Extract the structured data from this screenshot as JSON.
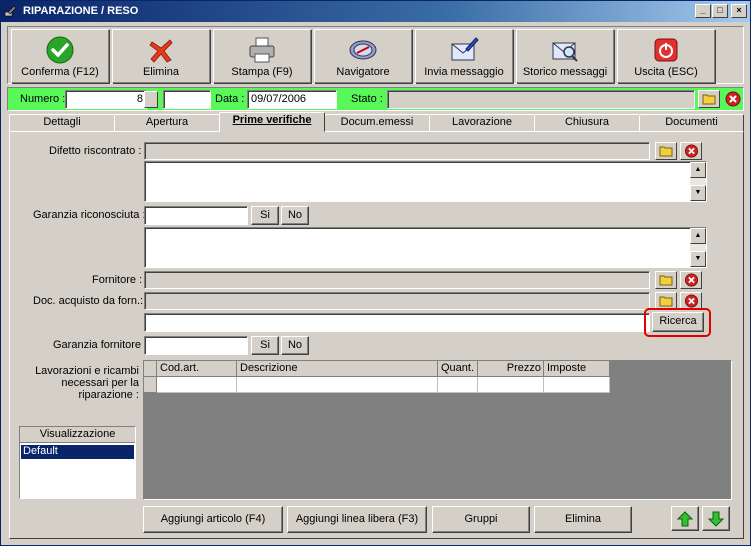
{
  "window": {
    "title": "RIPARAZIONE / RESO",
    "controls": {
      "minimize": "_",
      "maximize": "□",
      "close": "×"
    }
  },
  "toolbar": {
    "buttons": [
      {
        "label": "Conferma (F12)",
        "icon": "checkmark-icon"
      },
      {
        "label": "Elimina",
        "icon": "delete-x-icon"
      },
      {
        "label": "Stampa (F9)",
        "icon": "printer-icon"
      },
      {
        "label": "Navigatore",
        "icon": "compass-icon"
      },
      {
        "label": "Invia messaggio",
        "icon": "envelope-pen-icon"
      },
      {
        "label": "Storico messaggi",
        "icon": "envelope-search-icon"
      },
      {
        "label": "Uscita (ESC)",
        "icon": "power-icon"
      }
    ]
  },
  "header": {
    "numero_label": "Numero :",
    "numero_value": "8",
    "data_label": "Data :",
    "data_value": "09/07/2006",
    "stato_label": "Stato :",
    "stato_value": ""
  },
  "tabs": [
    {
      "label": "Dettagli",
      "active": false
    },
    {
      "label": "Apertura",
      "active": false
    },
    {
      "label": "Prime verifiche",
      "active": true
    },
    {
      "label": "Docum.emessi",
      "active": false
    },
    {
      "label": "Lavorazione",
      "active": false
    },
    {
      "label": "Chiusura",
      "active": false
    },
    {
      "label": "Documenti",
      "active": false
    }
  ],
  "form": {
    "difetto_label": "Difetto riscontrato :",
    "garanzia_label": "Garanzia riconosciuta :",
    "si_label": "Si",
    "no_label": "No",
    "fornitore_label": "Fornitore :",
    "doc_acquisto_label": "Doc. acquisto da forn.:",
    "ricerca_label": "Ricerca",
    "garanzia_fornitore_label": "Garanzia fornitore :",
    "lavorazioni_label": "Lavorazioni e ricambi necessari per la riparazione :"
  },
  "grid": {
    "columns": [
      "Cod.art.",
      "Descrizione",
      "Quant.",
      "Prezzo",
      "Imposte"
    ]
  },
  "visualizzazione": {
    "header": "Visualizzazione",
    "items": [
      "Default"
    ],
    "selected": "Default"
  },
  "bottom_buttons": {
    "aggiungi_articolo": "Aggiungi articolo (F4)",
    "aggiungi_linea": "Aggiungi linea libera (F3)",
    "gruppi": "Gruppi",
    "elimina": "Elimina"
  },
  "colors": {
    "accent_green": "#58f858",
    "title_blue": "#0a246a",
    "highlight_red": "#e00000",
    "selected_blue": "#0a246a"
  }
}
